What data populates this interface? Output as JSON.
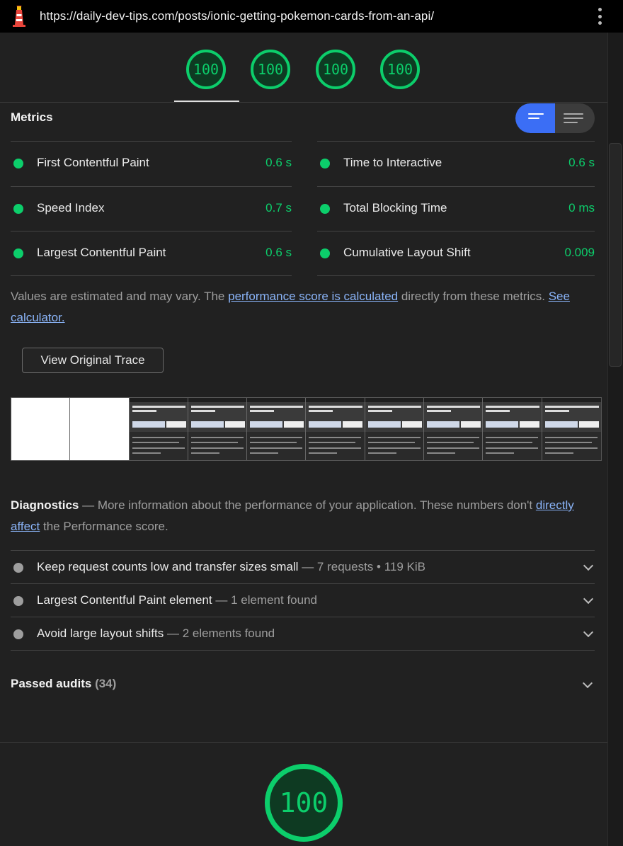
{
  "browser": {
    "url": "https://daily-dev-tips.com/posts/ionic-getting-pokemon-cards-from-an-api/",
    "icon": "lighthouse-icon"
  },
  "gauges": [
    "100",
    "100",
    "100",
    "100"
  ],
  "metrics": {
    "title": "Metrics",
    "items": [
      {
        "label": "First Contentful Paint",
        "value": "0.6 s"
      },
      {
        "label": "Time to Interactive",
        "value": "0.6 s"
      },
      {
        "label": "Speed Index",
        "value": "0.7 s"
      },
      {
        "label": "Total Blocking Time",
        "value": "0 ms"
      },
      {
        "label": "Largest Contentful Paint",
        "value": "0.6 s"
      },
      {
        "label": "Cumulative Layout Shift",
        "value": "0.009"
      }
    ],
    "status_color": "#0cce6b",
    "note_prefix": "Values are estimated and may vary. The ",
    "note_link1": "performance score is calculated",
    "note_middle": " directly from these metrics. ",
    "note_link2": "See calculator."
  },
  "trace_button": "View Original Trace",
  "diagnostics": {
    "title": "Diagnostics",
    "dash": " — ",
    "desc_prefix": "More information about the performance of your application. These numbers don't ",
    "desc_link": "directly affect",
    "desc_suffix": " the Performance score.",
    "audits": [
      {
        "label": "Keep request counts low and transfer sizes small",
        "sub": "7 requests • 119 KiB"
      },
      {
        "label": "Largest Contentful Paint element",
        "sub": "1 element found"
      },
      {
        "label": "Avoid large layout shifts",
        "sub": "2 elements found"
      }
    ]
  },
  "passed": {
    "label": "Passed audits",
    "count": "(34)"
  },
  "score": "100"
}
